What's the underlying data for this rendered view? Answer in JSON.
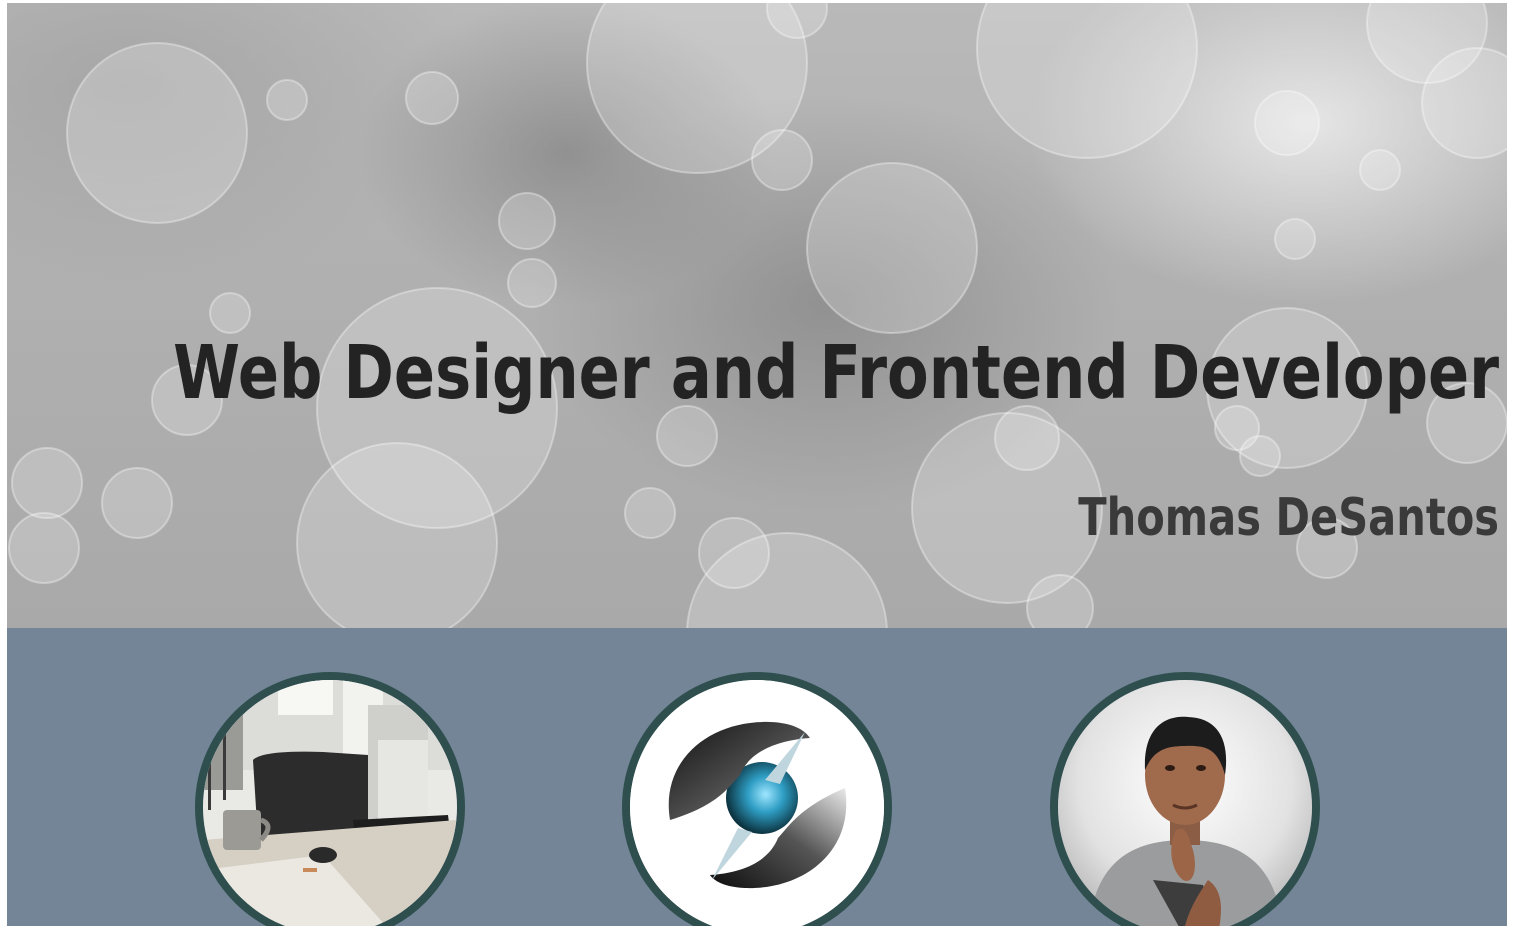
{
  "hero": {
    "title": "Web Designer and Frontend Developer",
    "name": "Thomas DeSantos"
  },
  "features": {
    "items": [
      {
        "image": "workspace-desk-photo"
      },
      {
        "image": "s-logo-icon"
      },
      {
        "image": "portrait-photo"
      }
    ]
  },
  "colors": {
    "band": "#738596",
    "ring": "#2f4f4f",
    "title_text": "#232323",
    "name_text": "#3a3a3a"
  }
}
